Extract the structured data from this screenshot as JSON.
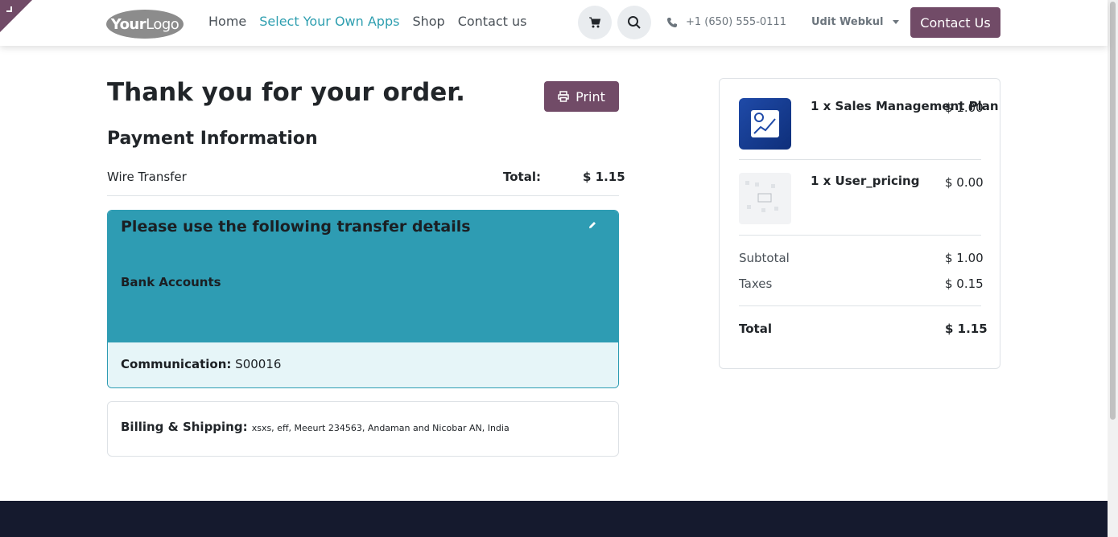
{
  "header": {
    "logo": {
      "part1": "Your",
      "part2": "Logo"
    },
    "nav": [
      "Home",
      "Select Your Own Apps",
      "Shop",
      "Contact us"
    ],
    "active_nav": "Select Your Own Apps",
    "phone": "+1 (650) 555-0111",
    "user": "Udit Webkul",
    "contact_button": "Contact Us"
  },
  "order": {
    "title": "Thank you for your order.",
    "print_button": "Print",
    "payment_heading": "Payment Information",
    "payment_method": "Wire Transfer",
    "total_label": "Total:",
    "total_value": "$ 1.15"
  },
  "transfer": {
    "title": "Please use the following transfer details",
    "bank_accounts": "Bank Accounts",
    "communication_label": "Communication:",
    "communication_value": "S00016"
  },
  "billing": {
    "label": "Billing & Shipping:",
    "address": "xsxs, eff, Meeurt 234563, Andaman and Nicobar AN, India"
  },
  "summary": {
    "items": [
      {
        "name": "1 x Sales Management Plan",
        "price": "$ 1.00"
      },
      {
        "name": "1 x User_pricing",
        "price": "$ 0.00"
      }
    ],
    "subtotal_label": "Subtotal",
    "subtotal_value": "$ 1.00",
    "taxes_label": "Taxes",
    "taxes_value": "$ 0.15",
    "total_label": "Total",
    "total_value": "$ 1.15"
  },
  "colors": {
    "brand": "#714b67",
    "accent": "#2f9fb0",
    "transfer_bg": "#2e9cb3",
    "footer_bg": "#151a2e"
  }
}
